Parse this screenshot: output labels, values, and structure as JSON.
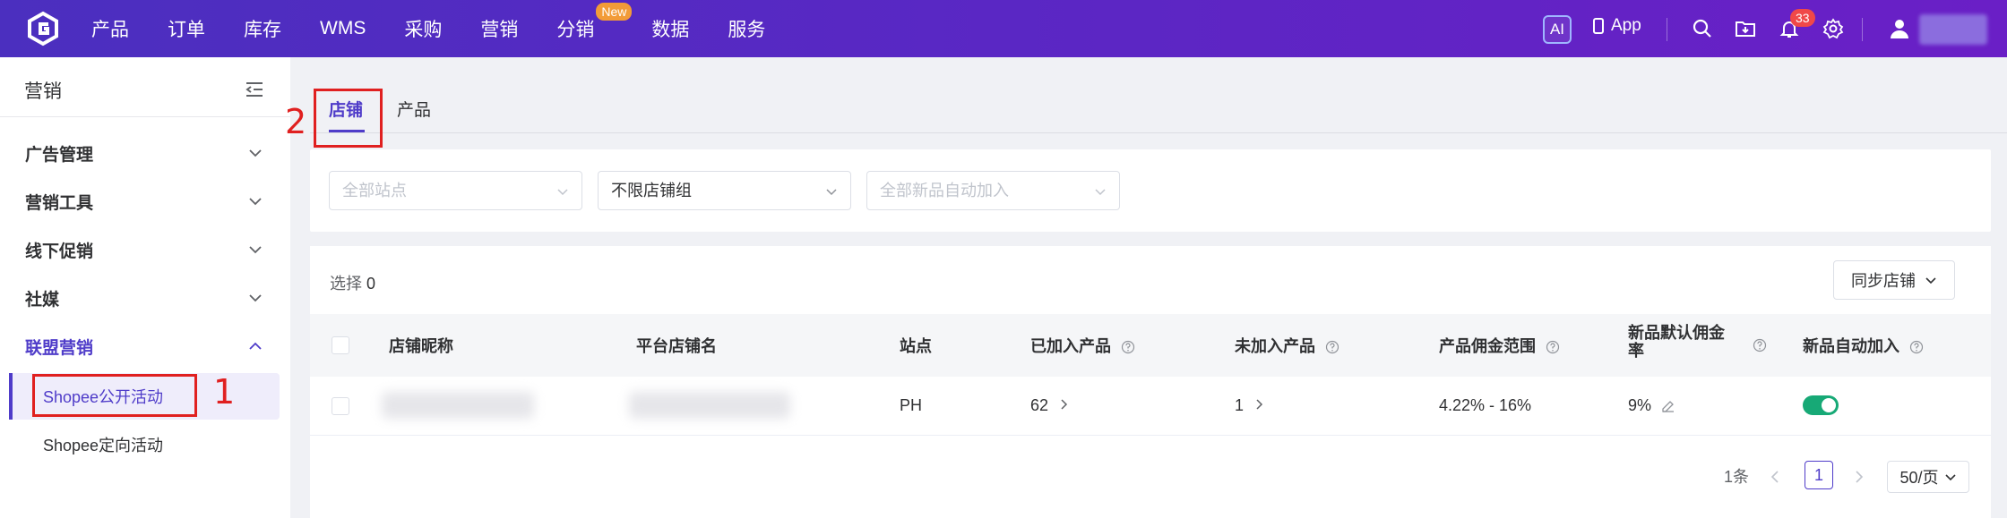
{
  "topbar": {
    "nav": [
      {
        "label": "产品"
      },
      {
        "label": "订单"
      },
      {
        "label": "库存"
      },
      {
        "label": "WMS"
      },
      {
        "label": "采购"
      },
      {
        "label": "营销"
      },
      {
        "label": "分销",
        "badge": "New"
      },
      {
        "label": "数据"
      },
      {
        "label": "服务"
      }
    ],
    "ai_label": "AI",
    "app_label": "App",
    "notification_count": "33"
  },
  "sidebar": {
    "title": "营销",
    "groups": [
      {
        "label": "广告管理",
        "expanded": false
      },
      {
        "label": "营销工具",
        "expanded": false
      },
      {
        "label": "线下促销",
        "expanded": false
      },
      {
        "label": "社媒",
        "expanded": false
      },
      {
        "label": "联盟营销",
        "expanded": true
      }
    ],
    "sub_items": [
      {
        "label": "Shopee公开活动",
        "active": true
      },
      {
        "label": "Shopee定向活动",
        "active": false
      }
    ]
  },
  "annotations": {
    "one": "1",
    "two": "2"
  },
  "tabs": [
    {
      "label": "店铺",
      "active": true
    },
    {
      "label": "产品",
      "active": false
    }
  ],
  "filters": {
    "site": "全部站点",
    "shop_group": "不限店铺组",
    "auto_add": "全部新品自动加入"
  },
  "table": {
    "selected_label": "选择",
    "selected_count": "0",
    "sync_label": "同步店铺",
    "columns": [
      "店铺昵称",
      "平台店铺名",
      "站点",
      "已加入产品",
      "未加入产品",
      "产品佣金范围",
      "新品默认佣金率",
      "新品自动加入"
    ],
    "rows": [
      {
        "site": "PH",
        "added": "62",
        "not_added": "1",
        "commission_range": "4.22% - 16%",
        "default_rate": "9%",
        "auto_add": true
      }
    ]
  },
  "pagination": {
    "total": "1条",
    "current": "1",
    "page_size": "50/页"
  },
  "colors": {
    "accent": "#4f3cc9",
    "toggle_on": "#17a976",
    "annotation": "#e02020"
  }
}
